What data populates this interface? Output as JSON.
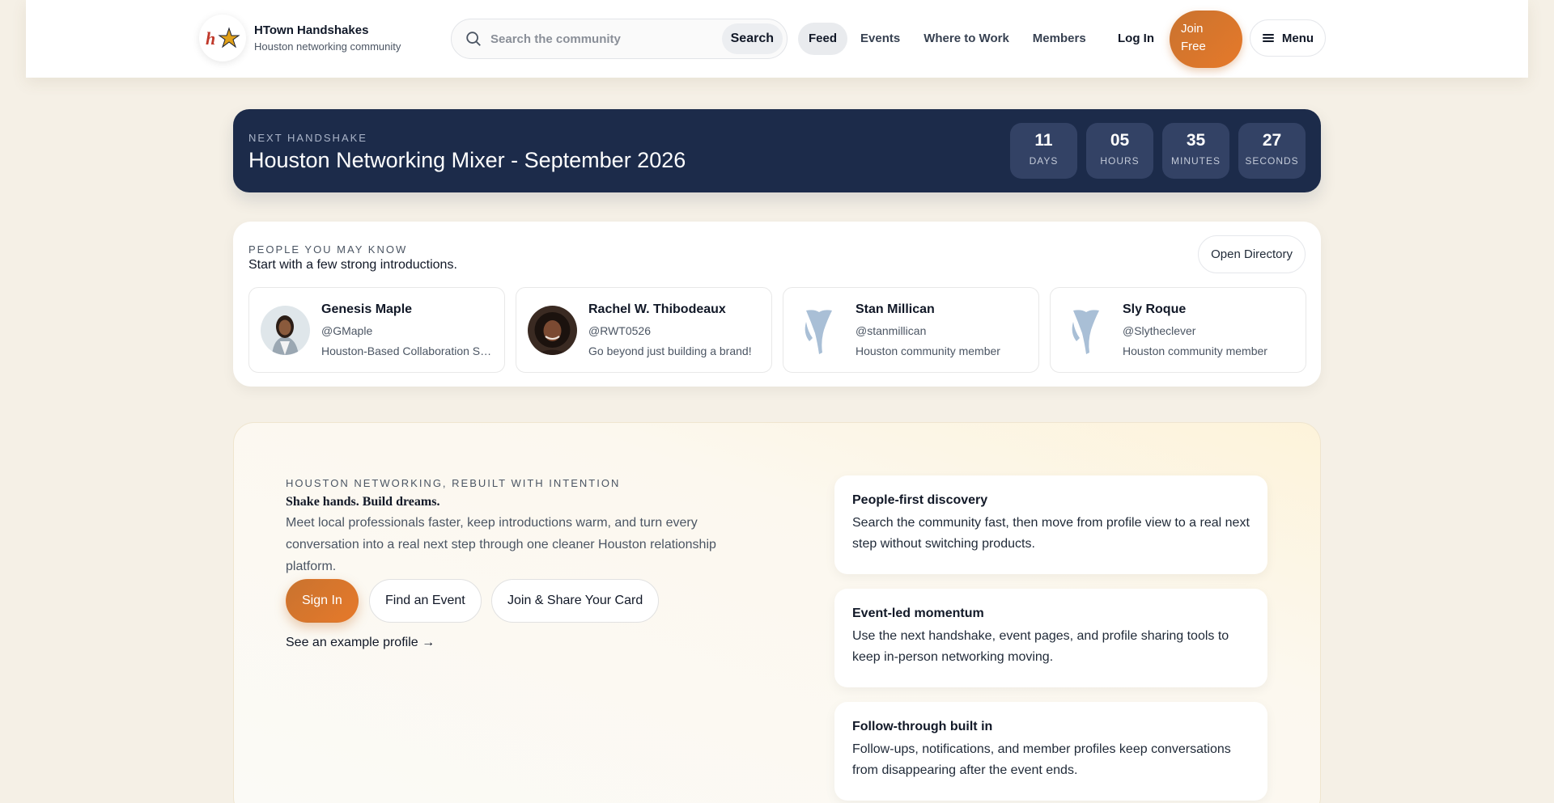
{
  "brand": {
    "title": "HTown Handshakes",
    "subtitle": "Houston networking community"
  },
  "search": {
    "placeholder": "Search the community",
    "button": "Search"
  },
  "nav": [
    "Feed",
    "Events",
    "Where to Work",
    "Members"
  ],
  "auth": {
    "login": "Log In",
    "join": "Join Free",
    "menu": "Menu"
  },
  "countdown": {
    "eyebrow": "NEXT HANDSHAKE",
    "title": "Houston Networking Mixer - September 2026",
    "units": [
      {
        "value": "11",
        "label": "DAYS"
      },
      {
        "value": "05",
        "label": "HOURS"
      },
      {
        "value": "35",
        "label": "MINUTES"
      },
      {
        "value": "27",
        "label": "SECONDS"
      }
    ]
  },
  "people": {
    "eyebrow": "PEOPLE YOU MAY KNOW",
    "subtitle": "Start with a few strong introductions.",
    "open_directory": "Open Directory",
    "list": [
      {
        "name": "Genesis Maple",
        "handle": "@GMaple",
        "bio": "Houston-Based Collaboration Space",
        "avatar": "photo"
      },
      {
        "name": "Rachel W. Thibodeaux",
        "handle": "@RWT0526",
        "bio": "Go beyond just building a brand!",
        "avatar": "photo"
      },
      {
        "name": "Stan Millican",
        "handle": "@stanmillican",
        "bio": "Houston community member",
        "avatar": "placeholder"
      },
      {
        "name": "Sly Roque",
        "handle": "@Slytheclever",
        "bio": "Houston community member",
        "avatar": "placeholder"
      }
    ]
  },
  "hero": {
    "eyebrow": "HOUSTON NETWORKING, REBUILT WITH INTENTION",
    "tagline": "Shake hands. Build dreams.",
    "description": "Meet local professionals faster, keep introductions warm, and turn every conversation into a real next step through one cleaner Houston relationship platform.",
    "buttons": [
      "Sign In",
      "Find an Event",
      "Join & Share Your Card"
    ],
    "link": "See an example profile →"
  },
  "features": [
    {
      "title": "People-first discovery",
      "text": "Search the community fast, then move from profile view to a real next step without switching products."
    },
    {
      "title": "Event-led momentum",
      "text": "Use the next handshake, event pages, and profile sharing tools to keep in-person networking moving."
    },
    {
      "title": "Follow-through built in",
      "text": "Follow-ups, notifications, and member profiles keep conversations from disappearing after the event ends."
    }
  ],
  "colors": {
    "accent": "#e6792a",
    "navy": "#1c2b4a",
    "background": "#f5f0e6"
  }
}
